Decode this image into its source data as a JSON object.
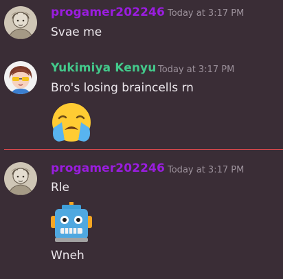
{
  "colors": {
    "background": "#3a2d36",
    "username_purple": "#9a1ddf",
    "username_green": "#43c98b",
    "timestamp": "#9c919b",
    "divider": "#d8484c"
  },
  "messages": [
    {
      "author": "progamer202246",
      "timestamp": "Today at 3:17 PM",
      "lines": [
        "Svae me"
      ],
      "avatar_icon": "sketch-avatar-icon"
    },
    {
      "author": "Yukimiya Kenyu",
      "timestamp": "Today at 3:17 PM",
      "lines": [
        "Bro's losing braincells rn"
      ],
      "emoji": "loudly-crying-face-icon",
      "avatar_icon": "anime-boy-avatar-icon"
    },
    {
      "author": "progamer202246",
      "timestamp": "Today at 3:17 PM",
      "lines": [
        "Rle",
        "Wneh"
      ],
      "emoji": "robot-face-icon",
      "avatar_icon": "sketch-avatar-icon"
    }
  ]
}
